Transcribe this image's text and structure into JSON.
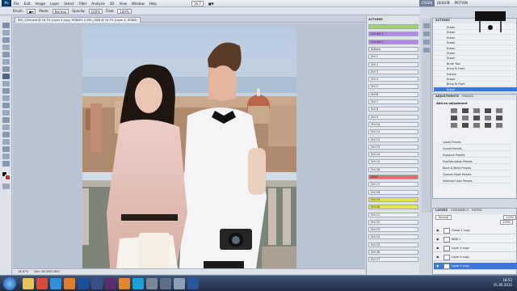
{
  "app": {
    "logo": "Ps",
    "zoom": "16,7",
    "screen_mode": "■▼"
  },
  "menubar": {
    "items": [
      "File",
      "Edit",
      "Image",
      "Layer",
      "Select",
      "Filter",
      "Analysis",
      "3D",
      "View",
      "Window",
      "Help"
    ]
  },
  "workspaces": [
    "ESSEN",
    "DESIGN",
    "MOTION"
  ],
  "options": {
    "brush_label": "Brush:",
    "mode_label": "Mode:",
    "mode_value": "Normal",
    "opacity_label": "Opacity:",
    "opacity_value": "100%",
    "flow_label": "Flow:",
    "flow_value": "100%"
  },
  "document_tab": {
    "title": "IMG_2394.psd @ 16,7% (Layer 4 copy, RGB/8*) ×   IMG_2408 @ 16,7% (Layer 4, RGB/8)"
  },
  "status_bar": {
    "zoom": "16,67%",
    "doc": "Doc: 85,0M/2,60G"
  },
  "swatch_panel": {
    "title": "ACTIONS",
    "items": [
      {
        "label": "",
        "color": "#9fd56b"
      },
      {
        "label": "Ctrl Set 1",
        "color": "#b28ae6"
      },
      {
        "label": "Ctrl Set 2",
        "color": "#b28ae6"
      },
      {
        "label": "Actions",
        "color": "#eef0f4"
      },
      {
        "label": "Ctrl 1",
        "color": "#eef0f4"
      },
      {
        "label": "Ctrl 2",
        "color": "#eef0f4"
      },
      {
        "label": "Ctrl 3",
        "color": "#eef0f4"
      },
      {
        "label": "Ctrl 4",
        "color": "#eef0f4"
      },
      {
        "label": "Ctrl 5",
        "color": "#eef0f4"
      },
      {
        "label": "Ctrl 6",
        "color": "#eef0f4"
      },
      {
        "label": "Ctrl 7",
        "color": "#eef0f4"
      },
      {
        "label": "Ctrl 8",
        "color": "#eef0f4"
      },
      {
        "label": "Ctrl 9",
        "color": "#eef0f4"
      },
      {
        "label": "Ctrl 10",
        "color": "#eef0f4"
      },
      {
        "label": "Ctrl 11",
        "color": "#eef0f4"
      },
      {
        "label": "Ctrl 12",
        "color": "#eef0f4"
      },
      {
        "label": "Ctrl 13",
        "color": "#eef0f4"
      },
      {
        "label": "Ctrl 14",
        "color": "#eef0f4"
      },
      {
        "label": "Ctrl 15",
        "color": "#eef0f4"
      },
      {
        "label": "Ctrl 16",
        "color": "#eef0f4"
      },
      {
        "label": "SAVE",
        "color": "#e86b6b"
      },
      {
        "label": "Ctrl 17",
        "color": "#eef0f4"
      },
      {
        "label": "Ctrl 18",
        "color": "#eef0f4"
      },
      {
        "label": "Ctrl 19",
        "color": "#e8e24f"
      },
      {
        "label": "Ctrl 20",
        "color": "#e8e24f"
      },
      {
        "label": "Ctrl 21",
        "color": "#eef0f4"
      },
      {
        "label": "Ctrl 22",
        "color": "#eef0f4"
      },
      {
        "label": "Ctrl 23",
        "color": "#eef0f4"
      },
      {
        "label": "Ctrl 24",
        "color": "#eef0f4"
      },
      {
        "label": "Ctrl 25",
        "color": "#eef0f4"
      },
      {
        "label": "Ctrl 26",
        "color": "#eef0f4"
      },
      {
        "label": "Ctrl 27",
        "color": "#eef0f4"
      }
    ]
  },
  "actions_panel": {
    "title": "ACTIONS",
    "items": [
      "Eraser",
      "Eraser",
      "Eraser",
      "Eraser",
      "Eraser",
      "Eraser",
      "Eraser",
      "Brush Tool",
      "Bring To Front",
      "Extract",
      "Eraser",
      "Bring To Front",
      "Eraser"
    ]
  },
  "adjustments": {
    "tabs": [
      "ADJUSTMENTS",
      "MASKS"
    ],
    "heading": "Add an adjustment",
    "presets": [
      "Levels Presets",
      "Curves Presets",
      "Exposure Presets",
      "Hue/Saturation Presets",
      "Black & White Presets",
      "Channel Mixer Presets",
      "Selective Color Presets"
    ]
  },
  "layers": {
    "tabs": [
      "LAYERS",
      "CHANNELS",
      "PATHS"
    ],
    "blend_mode": "Normal",
    "opacity": "100%",
    "fill": "100%",
    "items": [
      {
        "name": "Group 1 copy",
        "selected": false
      },
      {
        "name": "NEW 1",
        "selected": false
      },
      {
        "name": "Layer 4 copy",
        "selected": false
      },
      {
        "name": "Layer 4 copy",
        "selected": false
      },
      {
        "name": "Layer 4 copy",
        "selected": true
      }
    ]
  },
  "taskbar": {
    "time": "18:52",
    "date": "01.06.2012",
    "apps": [
      "explorer",
      "chrome",
      "media",
      "firefox",
      "photoshop",
      "lightroom",
      "premiere",
      "illustrator",
      "skype",
      "tool",
      "tool2",
      "tool3",
      "word"
    ]
  }
}
